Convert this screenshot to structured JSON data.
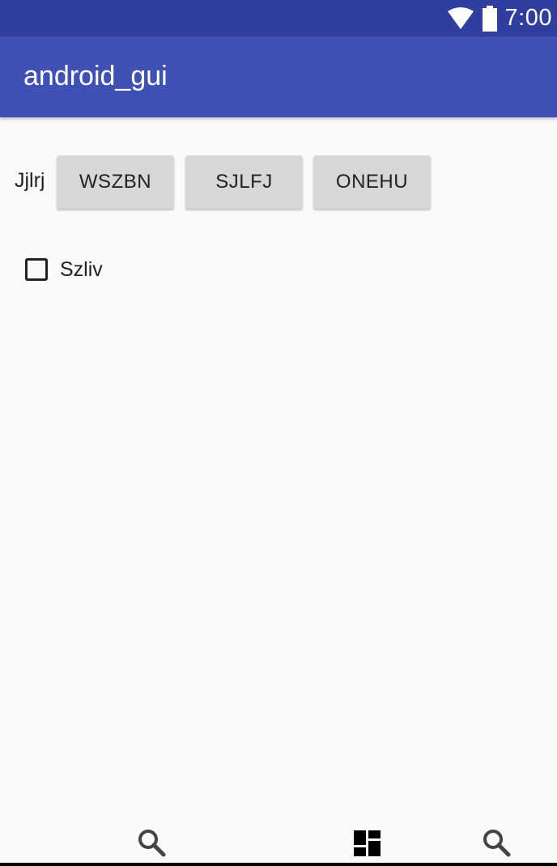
{
  "status_bar": {
    "time": "7:00",
    "icons": [
      "wifi-icon",
      "battery-icon"
    ]
  },
  "app_bar": {
    "title": "android_gui"
  },
  "button_row": {
    "label": "Jjlrj",
    "buttons": [
      {
        "label": "WSZBN"
      },
      {
        "label": "SJLFJ"
      },
      {
        "label": "ONEHU"
      }
    ]
  },
  "checkbox": {
    "label": "Szliv",
    "checked": false
  },
  "bottom_nav": {
    "icons": [
      "search-icon",
      "dashboard-icon",
      "search-icon"
    ]
  },
  "colors": {
    "status_bar": "#303f9f",
    "app_bar": "#3f51b5",
    "background": "#fafafa",
    "button": "#d6d7d7"
  }
}
